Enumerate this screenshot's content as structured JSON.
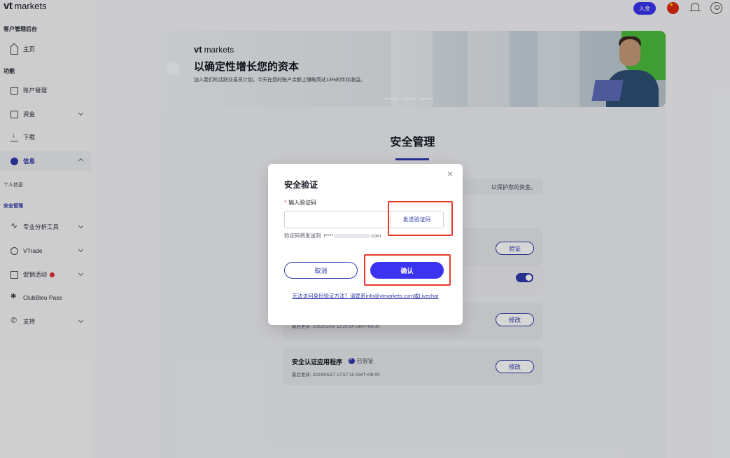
{
  "sidebar": {
    "logo_vt": "vt",
    "logo_markets": "markets",
    "section_admin": "客户管理后台",
    "home": "主页",
    "section_features": "功能",
    "account_management": "账户管理",
    "funds": "资金",
    "download": "下载",
    "information": "信息",
    "personal_info": "个人信息",
    "security_management": "安全管理",
    "pro_analysis_tools": "专业分析工具",
    "vtrade": "VTrade",
    "promotions": "促销活动",
    "clubbleu_pass": "ClubBleu Pass",
    "support": "支持"
  },
  "topbar": {
    "deposit": "入金"
  },
  "banner": {
    "logo_vt": "vt",
    "logo_markets": "markets",
    "title": "以确定性增长您的资本",
    "subtitle": "加入我们的活跃交易员计划，今天在您的账户余额上赚取高达13%的年化收益。"
  },
  "page": {
    "title": "安全管理",
    "notice_fragment": "以保护您的资金。",
    "rows": [
      {
        "button": "验证"
      },
      {
        "toggle_on": true
      },
      {
        "updated": "最后更新: 2023/11/09 13:29:34 GMT+08:00",
        "button": "修改"
      },
      {
        "name": "安全认证应用程序",
        "status": "已验证",
        "updated": "最后更新: 2024/05/17 17:57:10 GMT+08:00",
        "button": "修改"
      }
    ]
  },
  "modal": {
    "title": "安全验证",
    "required_mark": "*",
    "field_label": "输入验证码",
    "input_value": "",
    "send_code": "发送验证码",
    "sent_prefix": "验证码将发送到",
    "email_start": "t****",
    "email_end": "com",
    "cancel": "取消",
    "confirm": "确认",
    "help_link": "无法访问身份验证方法？请联系info@vtmarkets.com或Livechat",
    "close_icon": "close-icon"
  },
  "colors": {
    "primary": "#3a33ef",
    "brand_dark": "#2f3aa8",
    "annotation": "#e8382a"
  }
}
